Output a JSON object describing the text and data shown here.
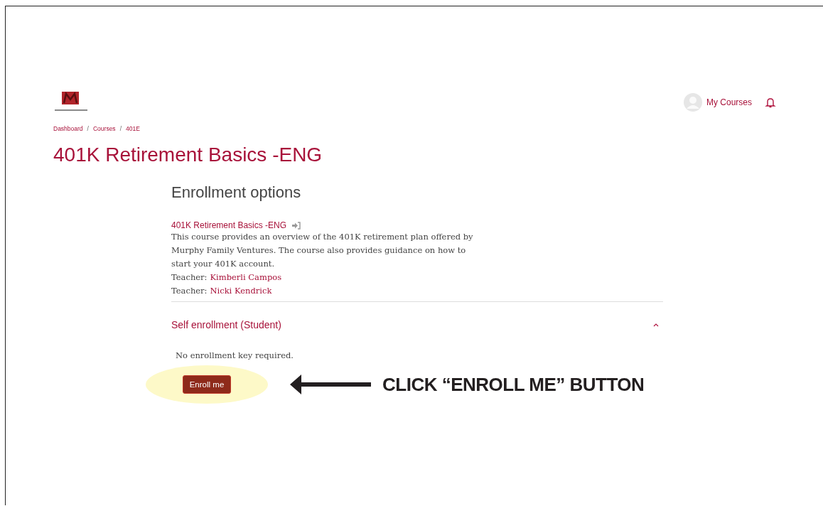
{
  "header": {
    "user_menu": "My Courses"
  },
  "breadcrumb": [
    {
      "kind": "link",
      "text": "Dashboard"
    },
    {
      "kind": "separator",
      "text": "/"
    },
    {
      "kind": "link",
      "text": "Courses"
    },
    {
      "kind": "separator",
      "text": "/"
    },
    {
      "kind": "link",
      "text": "401E"
    }
  ],
  "page_title": "401K Retirement Basics -ENG",
  "heading": "Enrollment options",
  "course": {
    "name": "401K Retirement Basics -ENG",
    "summary": "This course provides an overview of the 401K retirement plan offered by Murphy Family Ventures. The course also provides guidance on how to start your 401K account.",
    "teachers": [
      {
        "label": "Teacher:",
        "name": "Kimberli Campos"
      },
      {
        "label": "Teacher:",
        "name": "Nicki Kendrick"
      }
    ]
  },
  "section": {
    "title": "Self enrollment (Student)",
    "expanded": true,
    "note": "No enrollment key required.",
    "button": "Enroll me"
  },
  "callout": "CLICK “ENROLL ME” BUTTON"
}
